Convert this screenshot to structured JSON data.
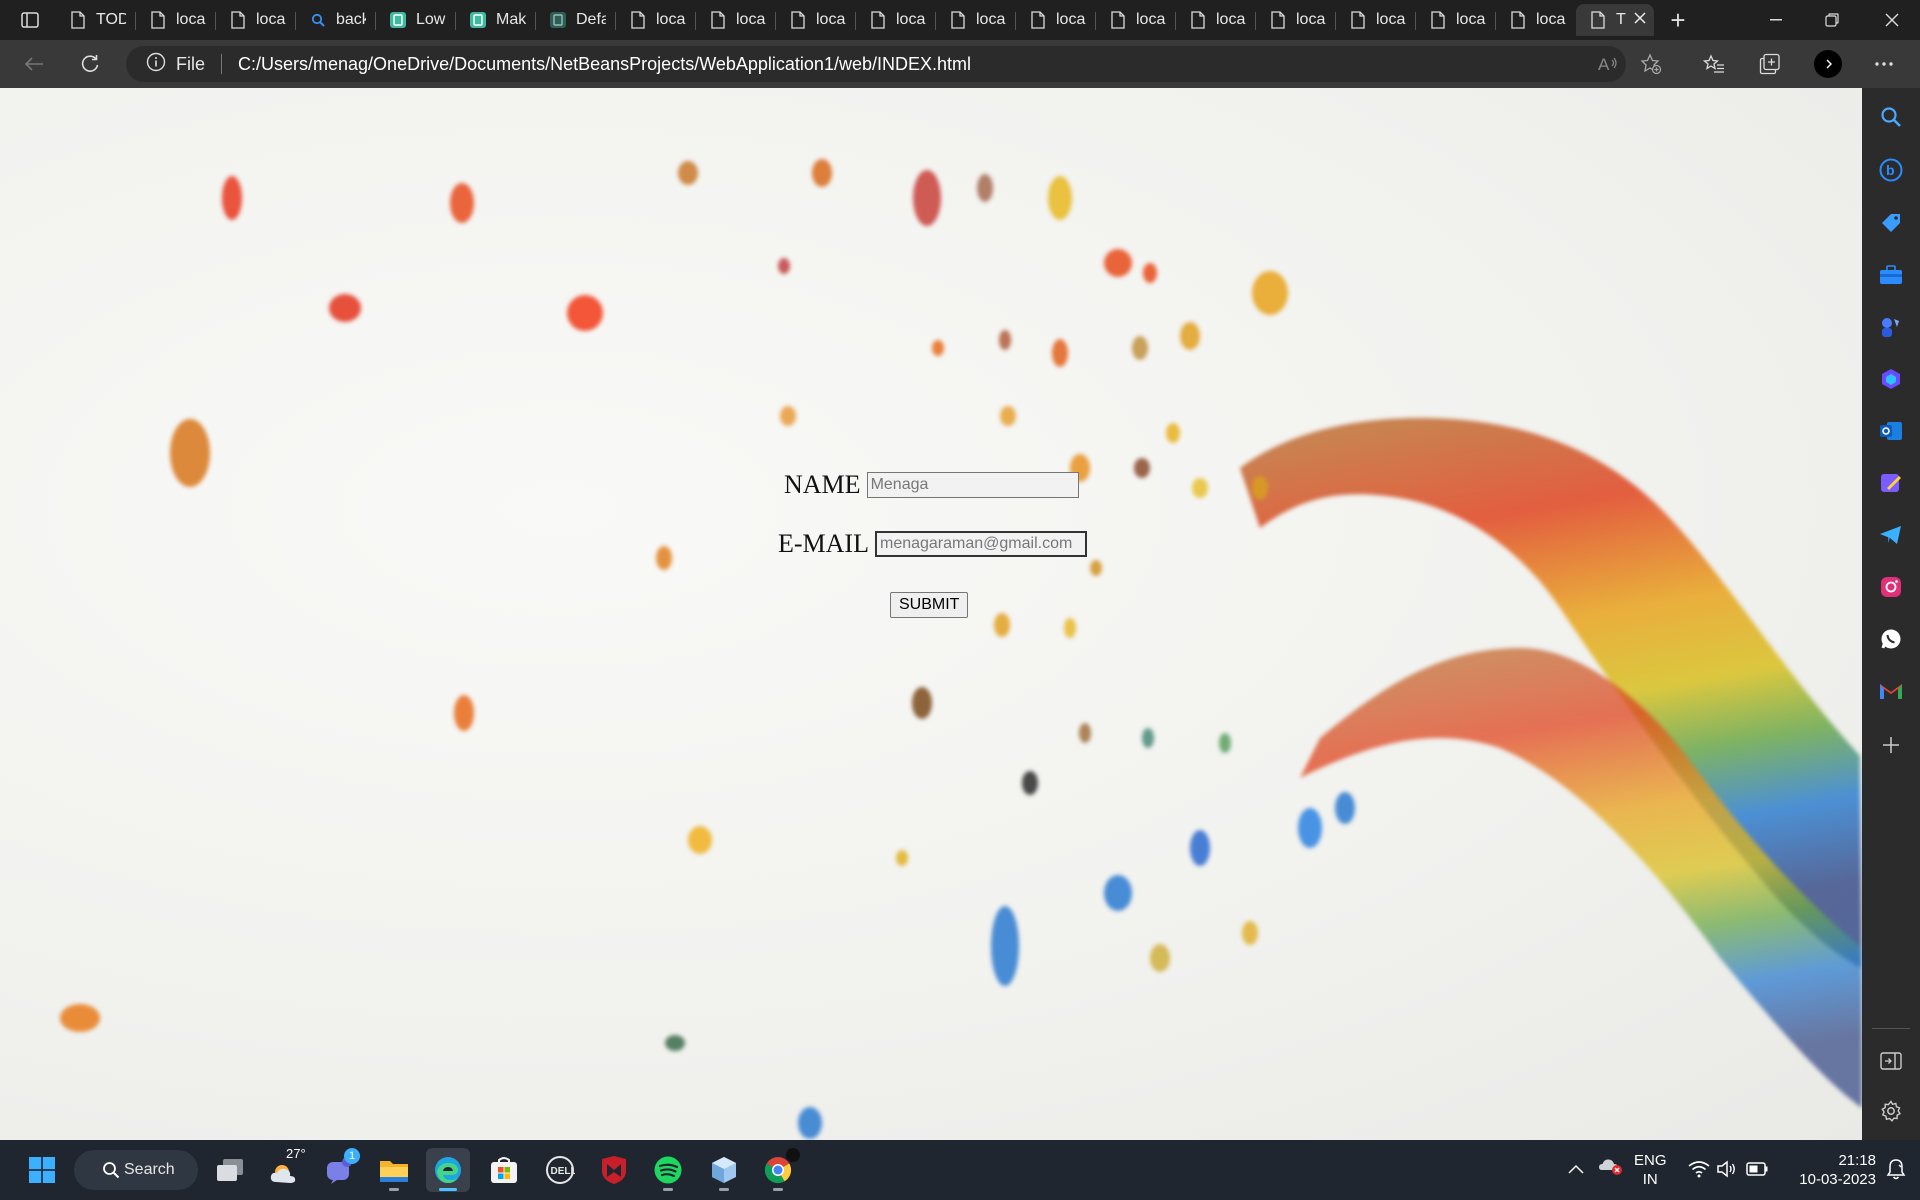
{
  "browser": {
    "tabs": [
      {
        "label": "TODO",
        "icon": "document"
      },
      {
        "label": "localhost",
        "icon": "document"
      },
      {
        "label": "localhost",
        "icon": "document"
      },
      {
        "label": "background",
        "icon": "search"
      },
      {
        "label": "Low",
        "icon": "app"
      },
      {
        "label": "Make",
        "icon": "app"
      },
      {
        "label": "Default",
        "icon": "app-dim"
      },
      {
        "label": "localhost",
        "icon": "document"
      },
      {
        "label": "localhost",
        "icon": "document"
      },
      {
        "label": "localhost",
        "icon": "document"
      },
      {
        "label": "localhost",
        "icon": "document"
      },
      {
        "label": "localhost",
        "icon": "document"
      },
      {
        "label": "localhost",
        "icon": "document"
      },
      {
        "label": "localhost",
        "icon": "document"
      },
      {
        "label": "localhost",
        "icon": "document"
      },
      {
        "label": "localhost",
        "icon": "document"
      },
      {
        "label": "localhost",
        "icon": "document"
      },
      {
        "label": "localhost",
        "icon": "document"
      },
      {
        "label": "localhost",
        "icon": "document"
      },
      {
        "label": "T",
        "icon": "document",
        "active": true
      }
    ],
    "address": {
      "scheme_label": "File",
      "url": "C:/Users/menag/OneDrive/Documents/NetBeansProjects/WebApplication1/web/INDEX.html"
    }
  },
  "form": {
    "name_label": "NAME",
    "name_placeholder": "Menaga",
    "email_label": "E-MAIL",
    "email_placeholder": "menagaraman@gmail.com",
    "submit_label": "SUBMIT"
  },
  "taskbar": {
    "search_label": "Search",
    "weather_temp": "27°",
    "teams_badge": "1",
    "language_line1": "ENG",
    "language_line2": "IN",
    "time": "21:18",
    "date": "10-03-2023"
  },
  "colors": {
    "accent": "#4cc2ff",
    "chrome_dark": "#202020",
    "toolbar": "#393939",
    "taskbar": "#1f2630"
  }
}
